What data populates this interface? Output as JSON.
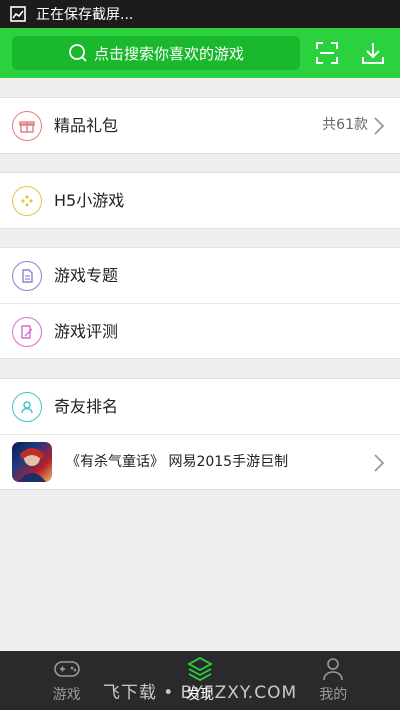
{
  "status_bar": {
    "text": "正在保存截屏..."
  },
  "header": {
    "search_placeholder": "点击搜索你喜欢的游戏"
  },
  "groups": {
    "gift": {
      "label": "精品礼包",
      "count": "共61款"
    },
    "h5": {
      "label": "H5小游戏"
    },
    "topic": {
      "label": "游戏专题"
    },
    "review": {
      "label": "游戏评测"
    },
    "rank": {
      "label": "奇友排名"
    },
    "promo": {
      "text": "《有杀气童话》 网易2015手游巨制"
    }
  },
  "bottom_nav": {
    "tabs": [
      {
        "label": "游戏"
      },
      {
        "label": "发现"
      },
      {
        "label": "我的"
      }
    ]
  },
  "watermark": "飞下载 • BYFZXY.COM",
  "colors": {
    "accent": "#2bd13e",
    "gift": "#e47b7b",
    "h5": "#e2c93a",
    "topic": "#8e7fd6",
    "review": "#d86bd2",
    "rank": "#3cc7c2"
  }
}
